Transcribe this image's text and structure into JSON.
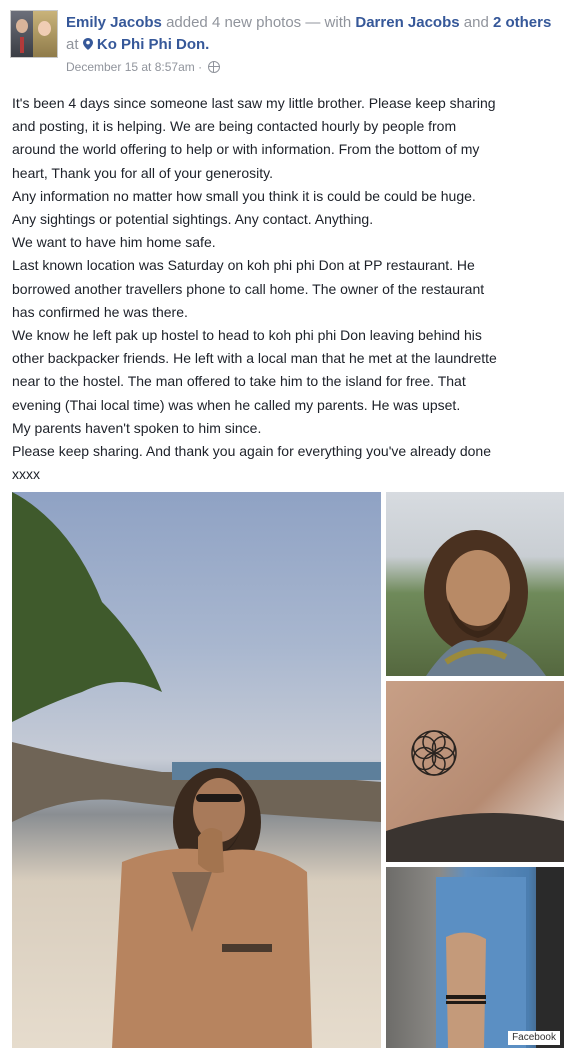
{
  "post": {
    "author": "Emily Jacobs",
    "action": "added 4 new photos",
    "with_prefix": "— with",
    "tagged_name": "Darren Jacobs",
    "others_joiner": "and",
    "others": "2 others",
    "at_word": "at",
    "location": "Ko Phi Phi Don.",
    "timestamp": "December 15 at 8:57am ·",
    "body_lines": [
      "It's been 4 days since someone last saw my little brother. Please keep sharing",
      "and posting, it is helping. We are being contacted hourly by people from",
      "around the world offering to help or with information. From the bottom of my",
      "heart, Thank you for all of your generosity.",
      "Any information no matter how small you think it is could be could be huge.",
      "Any sightings or potential sightings. Any contact. Anything.",
      "We want to have him home safe.",
      "Last known location was Saturday on koh phi phi Don at PP restaurant. He",
      "borrowed another travellers phone to call home. The owner of the restaurant",
      "has confirmed he was there.",
      "We know he left pak up hostel to head to koh phi phi Don leaving behind his",
      "other backpacker friends. He left with a local man that he met at the laundrette",
      "near to the hostel. The man offered to take him to the island for free. That",
      "evening (Thai local time) was when he called my parents. He was upset.",
      "My parents haven't spoken to him since.",
      "Please keep sharing. And thank you again for everything you've already done",
      "xxxx"
    ]
  },
  "photos": [
    {
      "subject": "man-on-beach-photo"
    },
    {
      "subject": "bearded-man-selfie-photo"
    },
    {
      "subject": "flower-of-life-tattoo-photo"
    },
    {
      "subject": "arm-bracelet-photo"
    }
  ],
  "watermark": "Facebook",
  "colors": {
    "link": "#365899",
    "meta": "#90949c",
    "text": "#1d2129"
  }
}
